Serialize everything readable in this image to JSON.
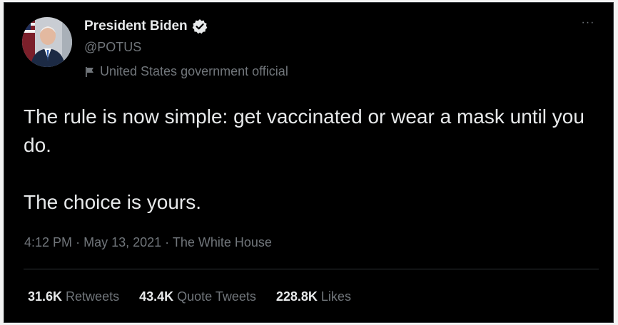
{
  "author": {
    "display_name": "President Biden",
    "handle": "@POTUS",
    "verified": true,
    "affiliation_label": "United States government official",
    "affiliation_icon": "flag-icon"
  },
  "menu": {
    "more_label": "···"
  },
  "tweet": {
    "paragraphs": [
      "The rule is now simple: get vaccinated or wear a mask until you do.",
      "The choice is yours."
    ]
  },
  "meta": {
    "time": "4:12 PM",
    "separator": "·",
    "date": "May 13, 2021",
    "source": "The White House"
  },
  "stats": {
    "retweets": {
      "count": "31.6K",
      "label": "Retweets"
    },
    "quote_tweets": {
      "count": "43.4K",
      "label": "Quote Tweets"
    },
    "likes": {
      "count": "228.8K",
      "label": "Likes"
    }
  },
  "colors": {
    "background": "#000000",
    "primary_text": "#e7e9ea",
    "secondary_text": "#71767b",
    "divider": "#2f3336"
  }
}
